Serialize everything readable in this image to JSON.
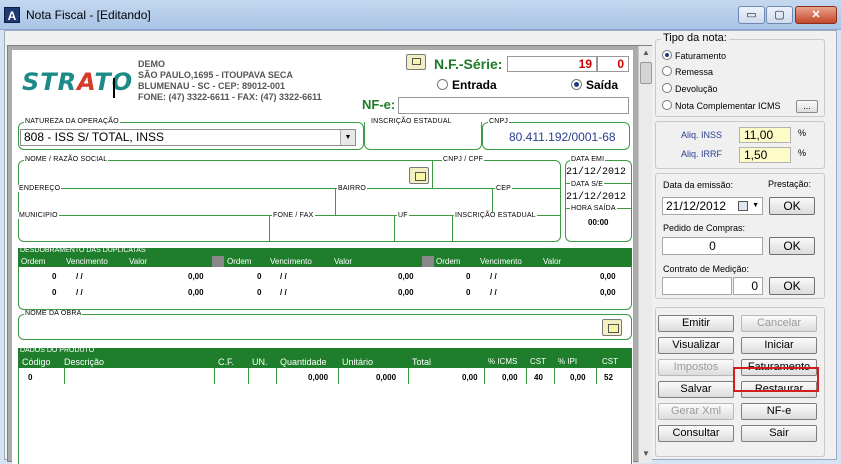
{
  "window": {
    "title": "Nota Fiscal - [Editando]",
    "app_icon": "A"
  },
  "controls": {
    "minimize": "▭",
    "maximize": "▢",
    "close": "✕"
  },
  "doc": {
    "logo_left": "STR",
    "logo_mid": "A",
    "logo_right": "TO",
    "company": {
      "name": "DEMO",
      "addr1": "SÃO PAULO,1695 - ITOUPAVA SECA",
      "addr2": "BLUMENAU - SC - CEP: 89012-001",
      "phone": "FONE: (47) 3322-6611 - FAX: (47) 3322-6611"
    },
    "nf_serie_label": "N.F.-Série:",
    "nf_number": "19",
    "serie": "0",
    "entrada": "Entrada",
    "saida": "Saída",
    "nfe_label": "NF-e:",
    "natureza_label": "NATUREZA DA OPERAÇÃO",
    "natureza_value": "808 - ISS S/ TOTAL, INSS",
    "ie_label": "INSCRIÇÃO ESTADUAL",
    "cnpj_label": "CNPJ",
    "cnpj_value": "80.411.192/0001-68",
    "nome_label": "NOME / RAZÃO SOCIAL",
    "cnpj_cpf_label": "CNPJ / CPF",
    "data_emi_label": "DATA EMI",
    "data_emi_value": "21/12/2012",
    "endereco_label": "ENDEREÇO",
    "bairro_label": "BAIRRO",
    "cep_label": "CEP",
    "data_sai_label": "DATA S/E",
    "data_sai_value": "21/12/2012",
    "municipio_label": "MUNICIPIO",
    "fone_label": "FONE / FAX",
    "uf_label": "UF",
    "ie2_label": "INSCRIÇÃO ESTADUAL",
    "hora_label": "HORA SAÍDA",
    "hora_value": "00:00",
    "dup_title": "DESDOBRAMENTO DAS DUPLICATAS",
    "dup_headers": [
      "Ordem",
      "Vencimento",
      "Valor"
    ],
    "dup_rows": [
      [
        "0",
        "/ /",
        "0,00",
        "0",
        "/ /",
        "0,00",
        "0",
        "/ /",
        "0,00"
      ],
      [
        "0",
        "/ /",
        "0,00",
        "0",
        "/ /",
        "0,00",
        "0",
        "/ /",
        "0,00"
      ]
    ],
    "obra_label": "NOME DA OBRA",
    "prod_title": "DADOS DO PRODUTO",
    "prod_headers": [
      "Código",
      "Descrição",
      "C.F.",
      "UN.",
      "Quantidade",
      "Unitário",
      "Total",
      "% ICMS",
      "CST",
      "% IPI",
      "CST"
    ],
    "prod_row": [
      "0",
      "",
      "",
      "",
      "0,000",
      "0,000",
      "0,00",
      "0,00",
      "40",
      "0,00",
      "52"
    ]
  },
  "tipo_nota": {
    "title": "Tipo da nota:",
    "options": [
      "Faturamento",
      "Remessa",
      "Devolução",
      "Nota Complementar ICMS"
    ],
    "selected": "Faturamento",
    "more_label": "..."
  },
  "aliq": {
    "inss_label": "Aliq. INSS",
    "inss_value": "11,00",
    "irrf_label": "Aliq. IRRF",
    "irrf_value": "1,50",
    "pct": "%"
  },
  "emissao": {
    "label": "Data da emissão:",
    "value": "21/12/2012",
    "prestacao_label": "Prestação:",
    "ok": "OK"
  },
  "pedido": {
    "label": "Pedido de Compras:",
    "value": "0",
    "ok": "OK"
  },
  "contrato": {
    "label": "Contrato de Medição:",
    "value": "",
    "value2": "0",
    "ok": "OK"
  },
  "actions": {
    "emitir": "Emitir",
    "cancelar": "Cancelar",
    "visualizar": "Visualizar",
    "iniciar": "Iniciar",
    "impostos": "Impostos",
    "faturamento": "Faturamento",
    "salvar": "Salvar",
    "restaurar": "Restaurar",
    "gerar_xml": "Gerar Xml",
    "nfe": "NF-e",
    "consultar": "Consultar",
    "sair": "Sair"
  },
  "colors": {
    "green": "#1e7e2c",
    "highlight": "#d21d1d",
    "accent_blue": "#2a3f8f"
  }
}
